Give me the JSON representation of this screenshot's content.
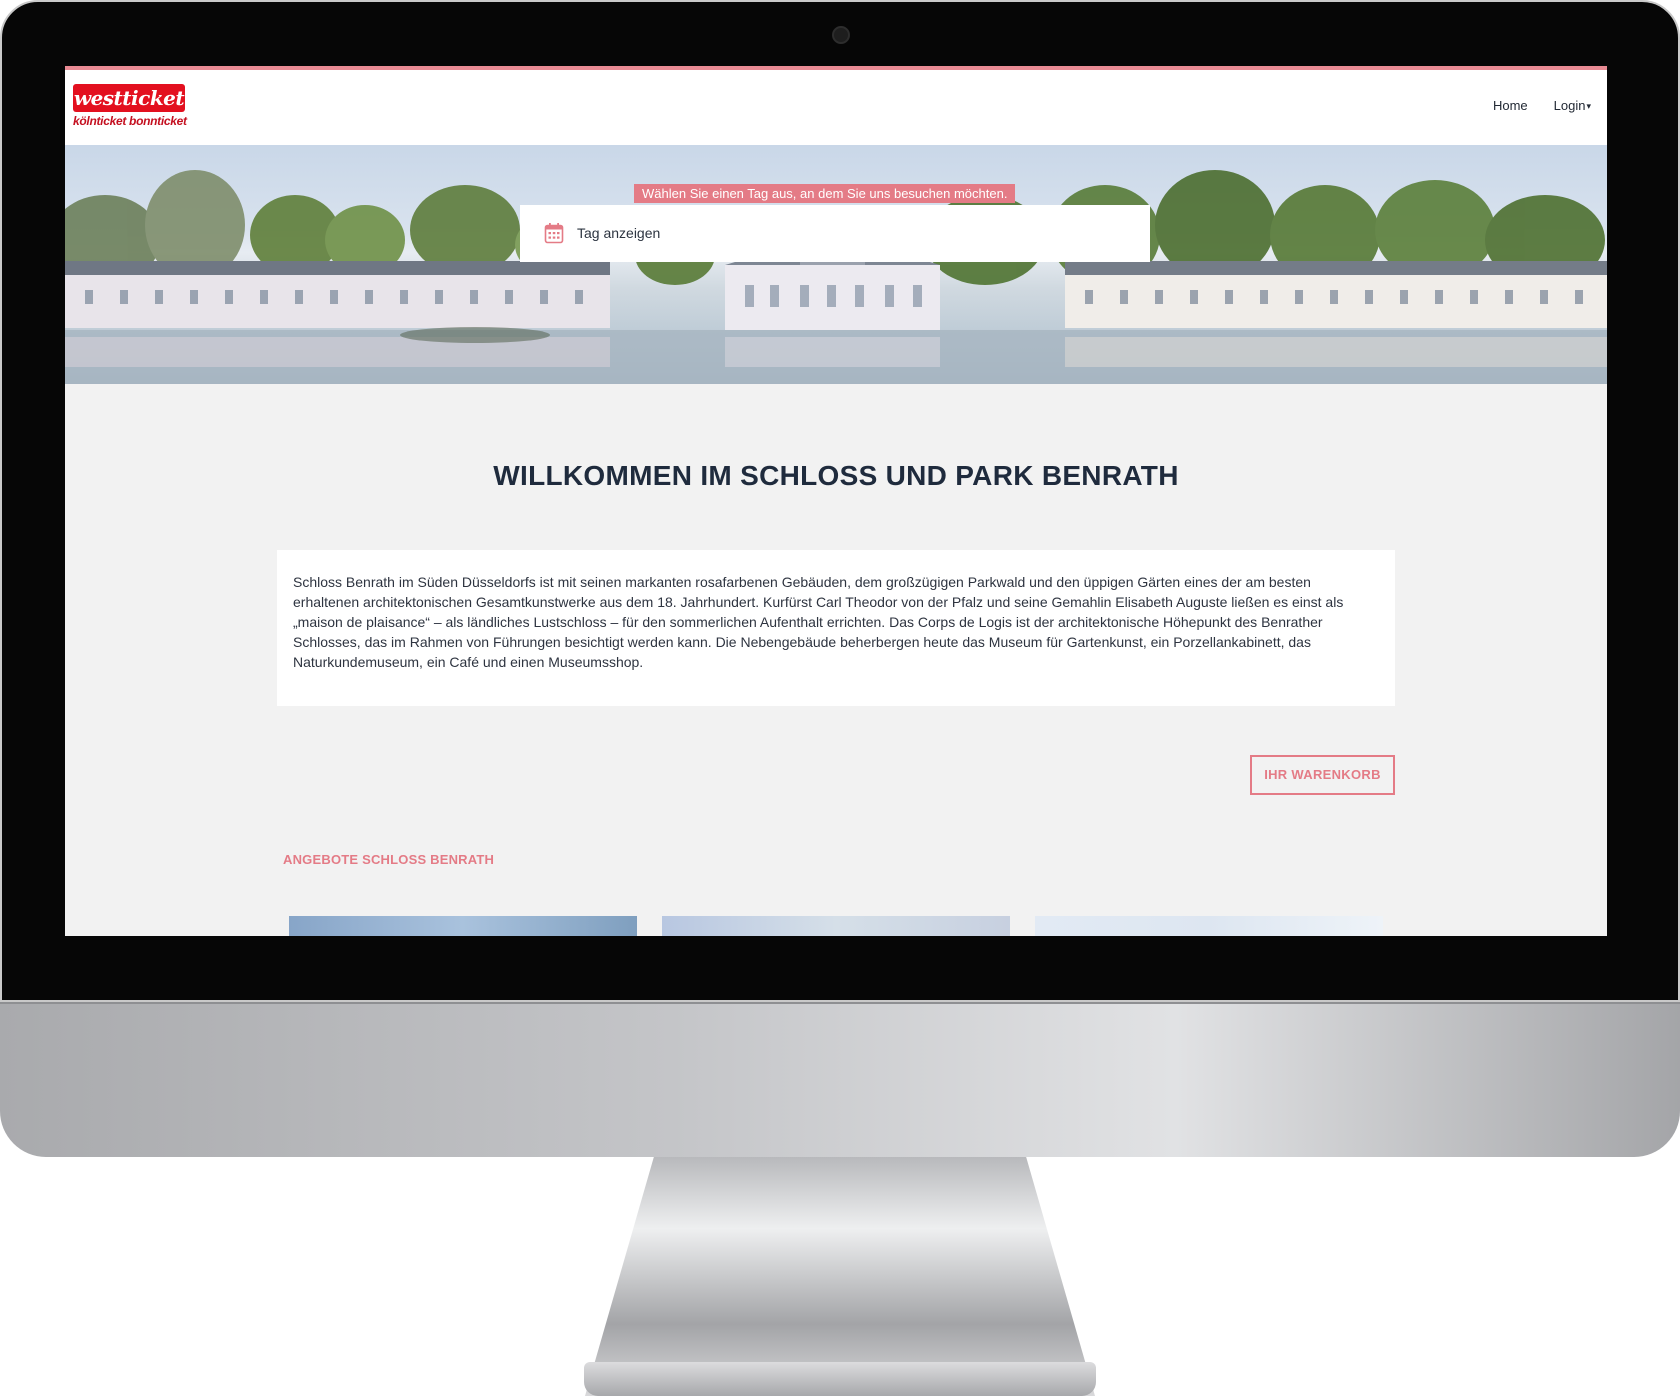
{
  "logo": {
    "brand": "westticket",
    "sub": "kölnticket bonnticket"
  },
  "nav": {
    "home": "Home",
    "login": "Login"
  },
  "hero": {
    "label": "Wählen Sie einen Tag aus, an dem Sie uns besuchen möchten.",
    "date_placeholder": "Tag anzeigen"
  },
  "main": {
    "title": "WILLKOMMEN IM SCHLOSS UND PARK BENRATH",
    "intro": "Schloss Benrath im Süden Düsseldorfs ist mit seinen markanten rosafarbenen Gebäuden, dem großzügigen Parkwald und den üppigen Gärten eines der am besten erhaltenen architektonischen Gesamtkunstwerke aus dem 18. Jahrhundert. Kurfürst Carl Theodor von der Pfalz und seine Gemahlin Elisabeth Auguste ließen es einst als „maison de plaisance“ – als ländliches Lustschloss – für den sommerlichen Aufenthalt errichten. Das Corps de Logis ist der architektonische Höhepunkt des Benrather Schlosses, das im Rahmen von Führungen besichtigt werden kann. Die Nebengebäude beherbergen heute das Museum für Gartenkunst, ein Porzellankabinett, das Naturkundemuseum, ein Café und einen Museumsshop.",
    "cart_button": "IHR WARENKORB",
    "offers_heading": "ANGEBOTE SCHLOSS BENRATH"
  },
  "colors": {
    "accent": "#e47b86",
    "brand_red": "#e3101f",
    "heading": "#1f2b3d",
    "page_bg": "#f2f2f2"
  },
  "icons": {
    "calendar": "calendar-icon",
    "login_caret": "caret-down-icon"
  }
}
